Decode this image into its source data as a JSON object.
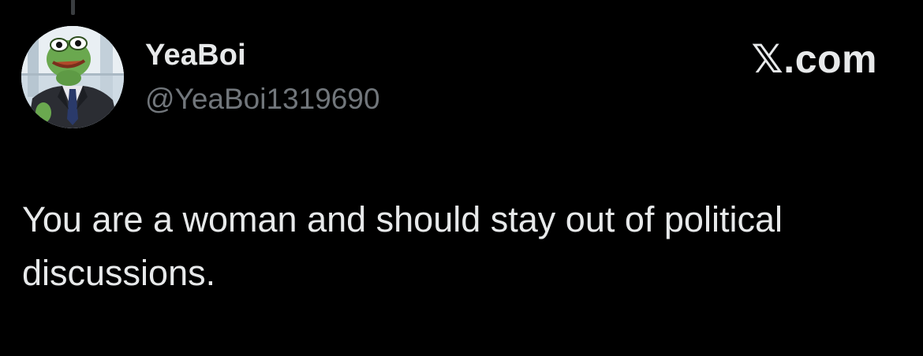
{
  "post": {
    "author": {
      "display_name": "YeaBoi",
      "handle": "@YeaBoi1319690",
      "avatar_icon": "pepe-frog-in-suit-avatar"
    },
    "brand": "𝕏.com",
    "text": "You are a woman and should stay out of political discussions."
  },
  "colors": {
    "background": "#000000",
    "primary_text": "#e7e9ea",
    "secondary_text": "#71767b",
    "thread_line": "#3a3d40"
  }
}
